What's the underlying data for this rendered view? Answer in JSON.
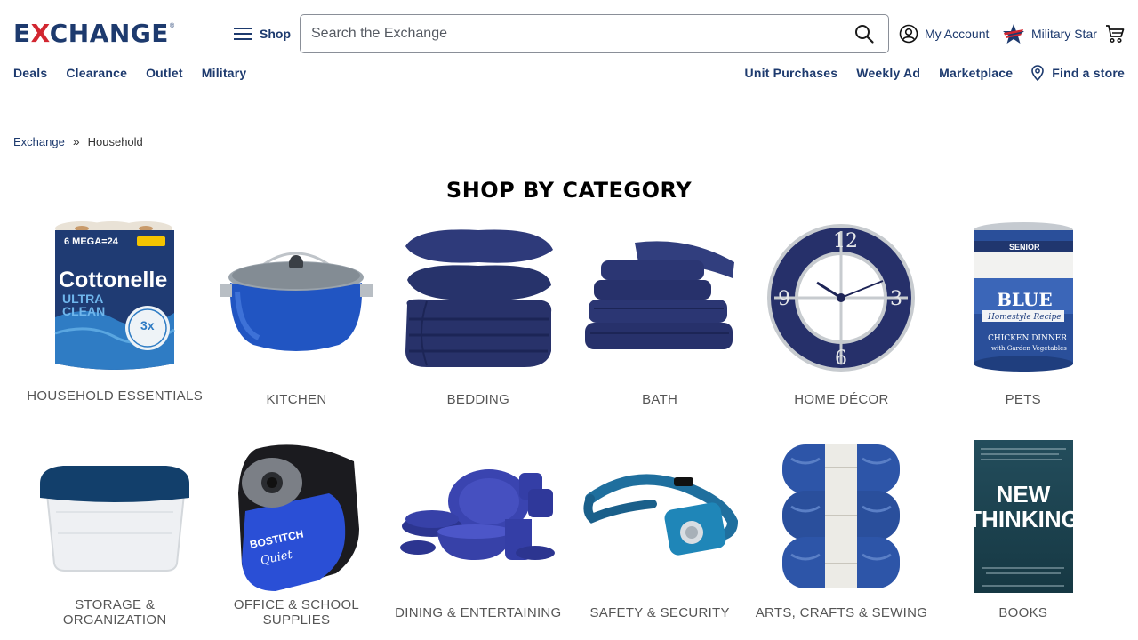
{
  "brand": {
    "logo_prefix": "E",
    "logo_x": "X",
    "logo_rest": "CHANGE",
    "logo_tm": "®"
  },
  "header": {
    "shop_label": "Shop",
    "search_placeholder": "Search the Exchange",
    "account_label": "My Account",
    "star_label": "Military Star"
  },
  "nav": {
    "left": [
      "Deals",
      "Clearance",
      "Outlet",
      "Military"
    ],
    "right": [
      "Unit Purchases",
      "Weekly Ad",
      "Marketplace"
    ],
    "find_store": "Find a store"
  },
  "breadcrumb": {
    "root": "Exchange",
    "separator": "»",
    "current": "Household"
  },
  "section_title": "SHOP BY CATEGORY",
  "categories": [
    {
      "label": "HOUSEHOLD ESSENTIALS",
      "icon": "toilet-paper-icon"
    },
    {
      "label": "KITCHEN",
      "icon": "stock-pot-icon"
    },
    {
      "label": "BEDDING",
      "icon": "comforter-icon"
    },
    {
      "label": "BATH",
      "icon": "towels-icon"
    },
    {
      "label": "HOME DÉCOR",
      "icon": "wall-clock-icon"
    },
    {
      "label": "PETS",
      "icon": "pet-food-can-icon"
    },
    {
      "label": "STORAGE & ORGANIZATION",
      "icon": "storage-bin-icon"
    },
    {
      "label": "OFFICE & SCHOOL SUPPLIES",
      "icon": "pencil-sharpener-icon"
    },
    {
      "label": "DINING & ENTERTAINING",
      "icon": "dinnerware-icon"
    },
    {
      "label": "SAFETY & SECURITY",
      "icon": "headlamp-icon"
    },
    {
      "label": "ARTS, CRAFTS & SEWING",
      "icon": "yarn-icon"
    },
    {
      "label": "BOOKS",
      "icon": "book-icon"
    }
  ],
  "product_text": {
    "tp_brand": "Cottonelle",
    "tp_line1": "ULTRA",
    "tp_line2": "CLEAN",
    "tp_badge": "6 MEGA=24",
    "tp_burst": "3x",
    "can_brand": "BLUE",
    "can_band": "SENIOR",
    "can_ribbon": "Homestyle Recipe",
    "can_line1": "CHICKEN DINNER",
    "can_line2": "with Garden Vegetables",
    "sharpener_brand": "BOSTITCH",
    "sharpener_model": "Quiet",
    "book_title1": "NEW",
    "book_title2": "THINKING"
  },
  "colors": {
    "brand_navy": "#1d3a6e",
    "brand_red": "#d22630",
    "product_navy": "#27336b"
  }
}
